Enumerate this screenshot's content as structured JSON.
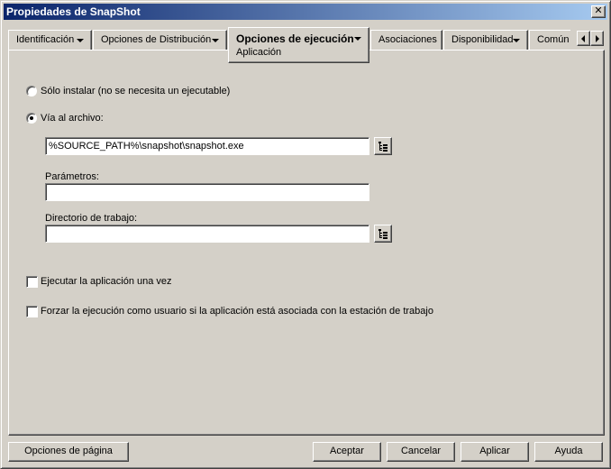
{
  "window": {
    "title": "Propiedades de SnapShot",
    "close_glyph": "✕"
  },
  "tabs": [
    {
      "label": "Identificación",
      "has_menu": true
    },
    {
      "label": "Opciones de Distribución",
      "has_menu": true
    },
    {
      "label": "Opciones de ejecución",
      "has_menu": true,
      "active": true,
      "subtab": "Aplicación"
    },
    {
      "label": "Asociaciones",
      "has_menu": false
    },
    {
      "label": "Disponibilidad",
      "has_menu": true
    },
    {
      "label": "Común",
      "has_menu": false
    }
  ],
  "form": {
    "radio_install_only": {
      "label": "Sólo instalar (no se necesita un ejecutable)",
      "checked": false
    },
    "radio_file_path": {
      "label": "Vía al archivo:",
      "checked": true
    },
    "file_path_value": "%SOURCE_PATH%\\snapshot\\snapshot.exe",
    "parameters_label": "Parámetros:",
    "parameters_value": "",
    "workdir_label": "Directorio de trabajo:",
    "workdir_value": "",
    "run_once": {
      "label": "Ejecutar la aplicación una vez",
      "checked": false
    },
    "force_run_as_user": {
      "label": "Forzar la ejecución como usuario si la aplicación está asociada con la estación de trabajo",
      "checked": false
    }
  },
  "buttons": {
    "page_options": "Opciones de página",
    "ok": "Aceptar",
    "cancel": "Cancelar",
    "apply": "Aplicar",
    "help": "Ayuda"
  },
  "icons": {
    "browse": "browse-tree-icon",
    "close": "close-icon",
    "tab_scroll_left": "arrow-left-icon",
    "tab_scroll_right": "arrow-right-icon"
  }
}
